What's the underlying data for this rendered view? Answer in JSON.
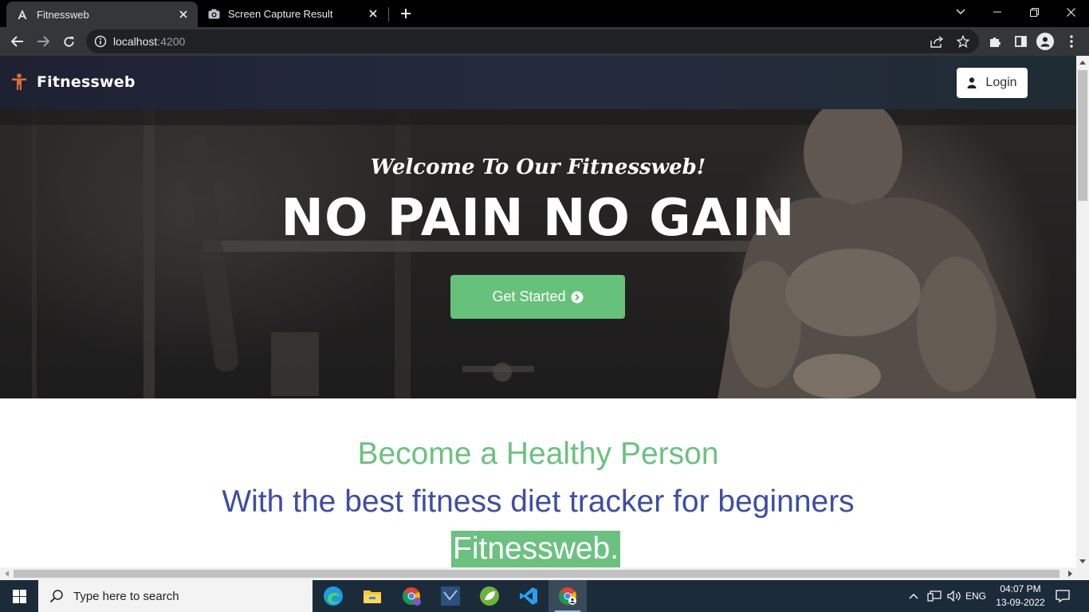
{
  "browser": {
    "tabs": [
      {
        "title": "Fitnessweb",
        "icon": "angular-icon",
        "active": true
      },
      {
        "title": "Screen Capture Result",
        "icon": "camera-icon",
        "active": false
      }
    ],
    "url_host": "localhost",
    "url_port": ":4200"
  },
  "navbar": {
    "brand": "Fitnessweb",
    "brand_icon": "person-icon",
    "login_label": "Login"
  },
  "hero": {
    "subtitle": "Welcome To Our Fitnessweb!",
    "title": "NO PAIN NO GAIN",
    "cta_label": "Get Started"
  },
  "section": {
    "line1": "Become a Healthy Person",
    "line2": "With the best fitness diet tracker for beginners",
    "line3": "Fitnessweb."
  },
  "taskbar": {
    "search_placeholder": "Type here to search",
    "apps": [
      "edge-icon",
      "file-explorer-icon",
      "chrome-profile-icon",
      "visual-studio-icon",
      "spring-icon",
      "vscode-icon",
      "chrome-icon"
    ],
    "language": "ENG",
    "time": "04:07 PM",
    "date": "13-09-2022"
  },
  "colors": {
    "accent_green": "#66c17a",
    "text_blue": "#3f4ea3",
    "navbar_dark": "#1d2132",
    "brand_icon_orange": "#e06a3b"
  }
}
